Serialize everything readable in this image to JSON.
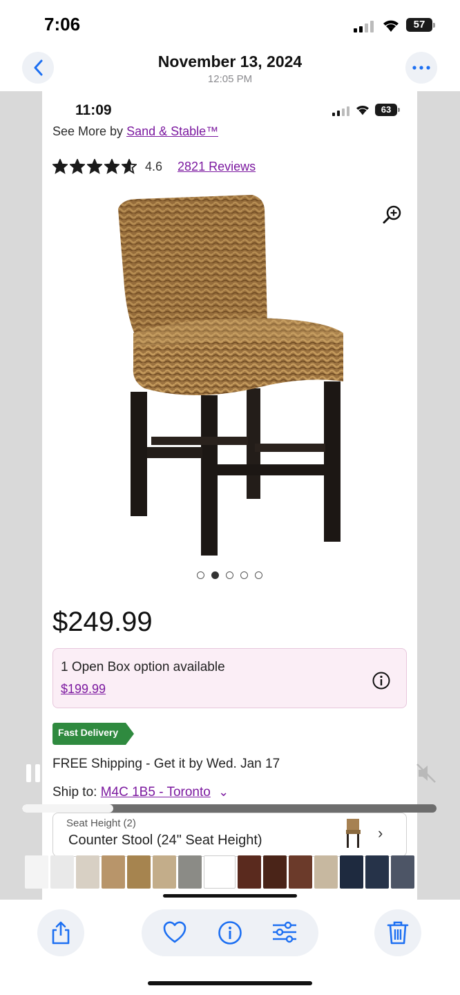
{
  "status_bar": {
    "time": "7:06",
    "battery": "57"
  },
  "photo_header": {
    "date": "November 13, 2024",
    "time": "12:05 PM"
  },
  "screenshot": {
    "status": {
      "time": "11:09",
      "battery": "63"
    },
    "see_more_prefix": "See More by ",
    "brand_link": "Sand & Stable™",
    "rating_value": "4.6",
    "rating_stars": 4.6,
    "reviews_link": "2821 Reviews",
    "carousel": {
      "total": 5,
      "active_index": 1
    },
    "price": "$249.99",
    "open_box": {
      "text": "1 Open Box option available",
      "price": "$199.99"
    },
    "fast_delivery_badge": "Fast Delivery",
    "shipping_text": "FREE Shipping - Get it by Wed. Jan 17",
    "ship_to_label": "Ship to:",
    "ship_to_location": "M4C 1B5 - Toronto",
    "seat_height": {
      "label": "Seat Height (2)",
      "value": "Counter Stool (24\" Seat Height)"
    },
    "colors": {
      "accent": "#7b189f",
      "badge_green": "#2f8a3f",
      "open_box_bg": "#fbeef6"
    }
  },
  "video": {
    "progress": 0.22
  },
  "thumbnails": [
    "#f4f4f4",
    "#e9e9e9",
    "#d8d0c4",
    "#b8956a",
    "#a6844f",
    "#c3ad8a",
    "#8b8b86",
    "#ffffff",
    "#5a2a1e",
    "#4a2418",
    "#6b3a2a",
    "#c7b8a0",
    "#1e2a3f",
    "#263349",
    "#4d5566"
  ],
  "toolbar": {
    "icons": [
      "share-icon",
      "heart-icon",
      "info-icon",
      "adjust-icon",
      "trash-icon"
    ],
    "accent": "#1c6ff2"
  }
}
